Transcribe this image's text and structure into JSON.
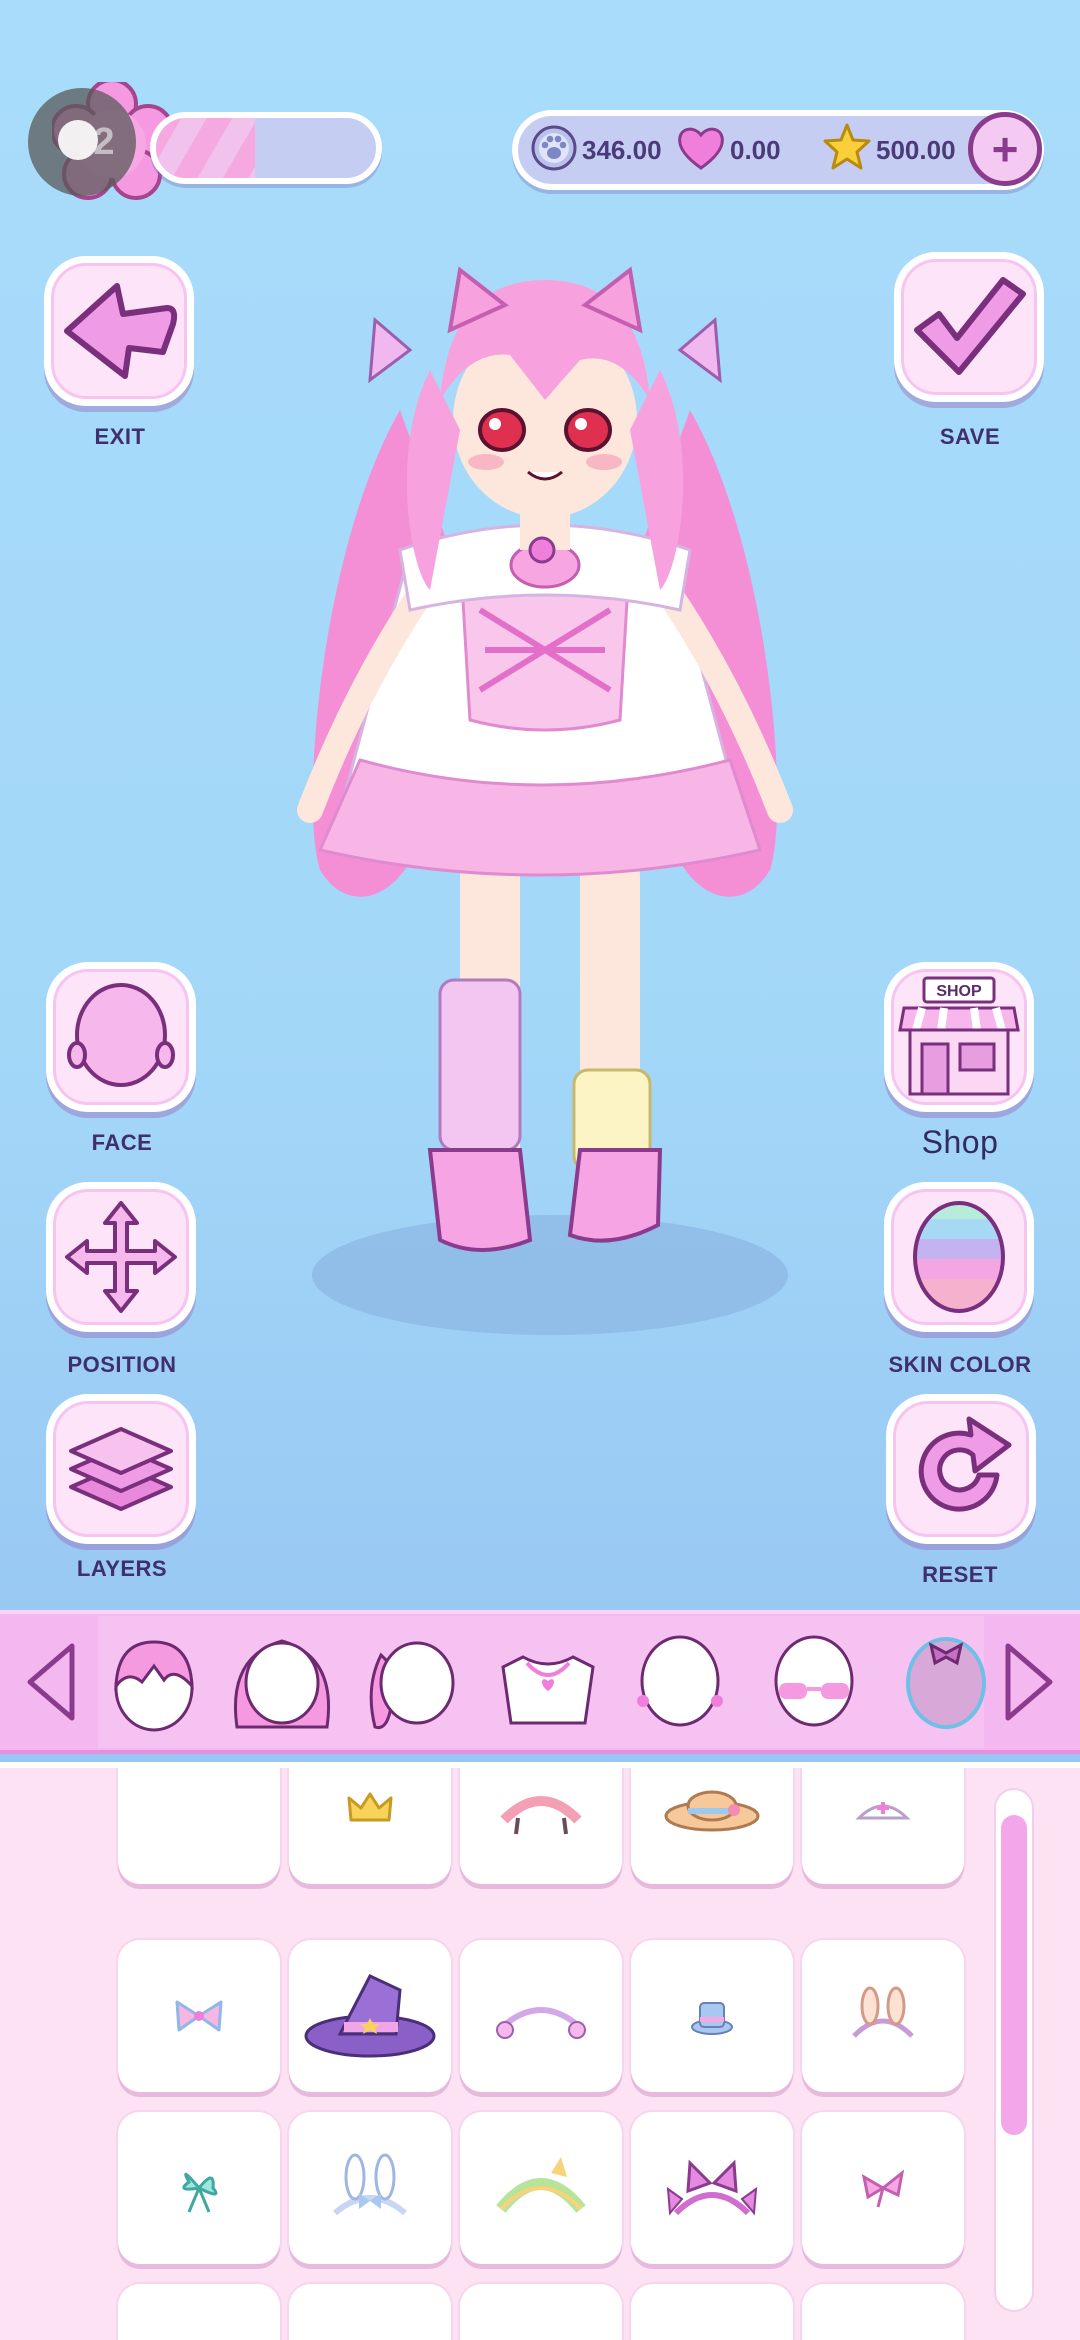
{
  "top_bar": {
    "level": "2",
    "xp_progress": 0.45,
    "currencies": [
      {
        "icon": "paw-coin-icon",
        "value": "346.00"
      },
      {
        "icon": "heart-icon",
        "value": "0.00"
      },
      {
        "icon": "star-icon",
        "value": "500.00"
      }
    ],
    "add_label": "+"
  },
  "left_buttons": [
    {
      "icon": "back-arrow-icon",
      "label": "EXIT"
    },
    {
      "icon": "face-icon",
      "label": "FACE"
    },
    {
      "icon": "move-arrows-icon",
      "label": "POSITION"
    },
    {
      "icon": "layers-icon",
      "label": "LAYERS"
    }
  ],
  "right_buttons": [
    {
      "icon": "checkmark-icon",
      "label": "SAVE"
    },
    {
      "icon": "shop-icon",
      "label": "Shop",
      "sign": "SHOP"
    },
    {
      "icon": "rainbow-head-icon",
      "label": "SKIN COLOR"
    },
    {
      "icon": "reset-arrow-icon",
      "label": "RESET"
    }
  ],
  "categories": [
    "hair-front-icon",
    "hair-back-icon",
    "hair-side-icon",
    "necklace-icon",
    "earrings-icon",
    "glasses-icon",
    "headwear-icon"
  ],
  "items": [
    [
      "empty",
      "crown",
      "headband-bows",
      "sun-hat",
      "nurse-cap"
    ],
    [
      "bow-pink",
      "witch-hat",
      "flower-tiara",
      "mini-top-hat",
      "bunny-ears-band"
    ],
    [
      "ribbon-mint",
      "bunny-bow-band",
      "green-headband",
      "cat-ears-band",
      "bow-clip"
    ]
  ],
  "colors": {
    "accent": "#f4b7ef",
    "button_bg": "#fde4f8",
    "icon_main": "#f09be6",
    "outline": "#8b3b8e"
  }
}
